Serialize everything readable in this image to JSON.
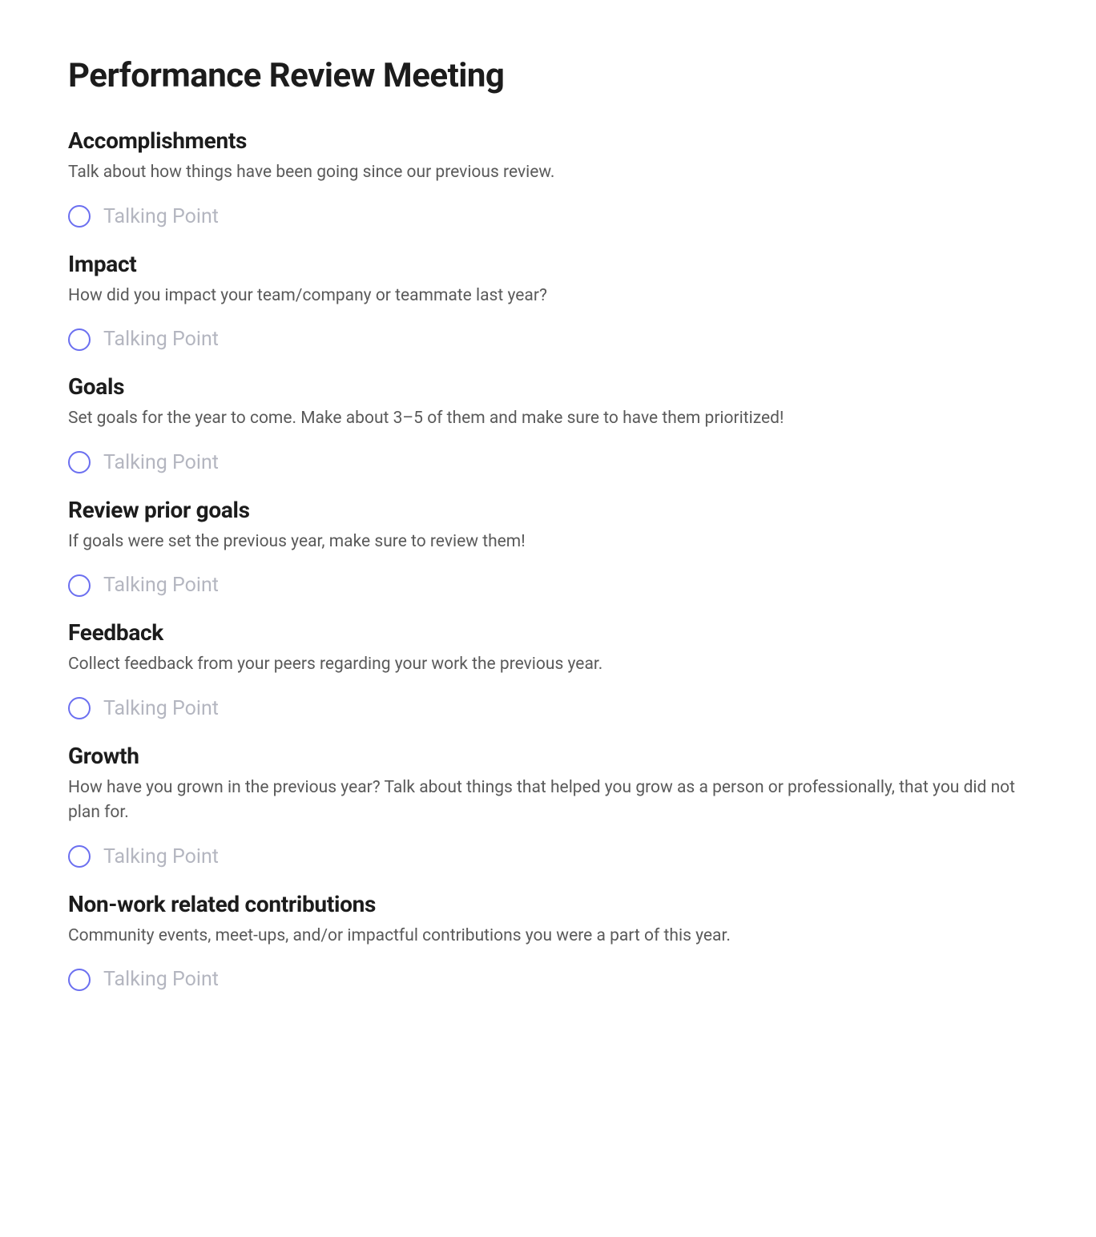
{
  "title": "Performance Review Meeting",
  "sections": [
    {
      "heading": "Accomplishments",
      "description": "Talk about how things have been going since our previous review.",
      "talking_point_label": "Talking Point"
    },
    {
      "heading": "Impact",
      "description": "How did you impact your team/company or teammate last year?",
      "talking_point_label": "Talking Point"
    },
    {
      "heading": "Goals",
      "description": "Set goals for the year to come. Make about 3–5 of them and make sure to have them prioritized!",
      "talking_point_label": "Talking Point"
    },
    {
      "heading": "Review prior goals",
      "description": "If goals were set the previous year, make sure to review them!",
      "talking_point_label": "Talking Point"
    },
    {
      "heading": "Feedback",
      "description": "Collect feedback from your peers regarding your work the previous year.",
      "talking_point_label": "Talking Point"
    },
    {
      "heading": "Growth",
      "description": "How have you grown in the previous year? Talk about things that helped you grow as a person or professionally, that you did not plan for.",
      "talking_point_label": "Talking Point"
    },
    {
      "heading": "Non-work related contributions",
      "description": "Community events, meet-ups, and/or impactful contributions you were a part of this year.",
      "talking_point_label": "Talking Point"
    }
  ]
}
